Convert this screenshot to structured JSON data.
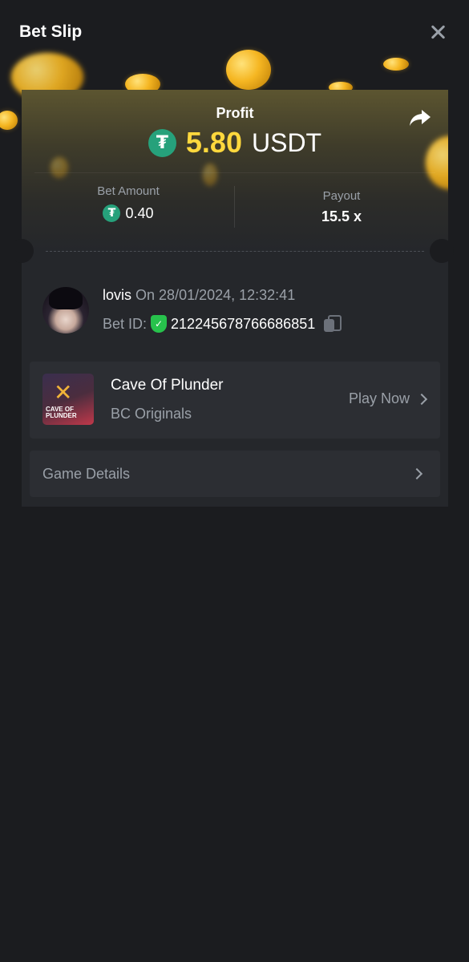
{
  "header": {
    "title": "Bet Slip",
    "close_icon": "close-icon"
  },
  "profit": {
    "label": "Profit",
    "value": "5.80",
    "currency": "USDT",
    "currency_icon": "tether-icon",
    "value_color": "#ffd83d"
  },
  "share_icon": "share-icon",
  "bet_amount": {
    "label": "Bet Amount",
    "value": "0.40",
    "currency_icon": "tether-icon"
  },
  "payout": {
    "label": "Payout",
    "value": "15.5 x"
  },
  "user": {
    "name": "lovis",
    "date_text": "On 28/01/2024, 12:32:41",
    "bet_id_label": "Bet ID:",
    "bet_id": "212245678766686851",
    "verified_icon": "shield-check-icon",
    "copy_icon": "copy-icon"
  },
  "game": {
    "name": "Cave Of Plunder",
    "provider": "BC Originals",
    "thumb_text_1": "CAVE OF",
    "thumb_text_2": "PLUNDER",
    "action_label": "Play Now"
  },
  "details": {
    "label": "Game Details"
  },
  "colors": {
    "background": "#1b1c1f",
    "card": "#25272b",
    "accent_green": "#26a17b",
    "muted_text": "#9aa0a8"
  }
}
